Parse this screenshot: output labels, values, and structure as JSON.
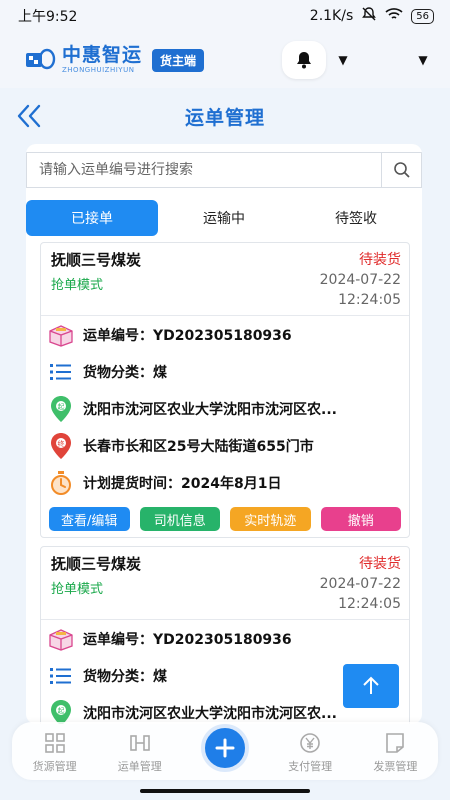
{
  "status_bar": {
    "time": "上午9:52",
    "network_speed": "2.1K/s",
    "battery": "56"
  },
  "header": {
    "brand_name": "中惠智运",
    "brand_sub": "ZHONGHUIZHIYUN",
    "role_badge": "货主端",
    "notification_icon": "bell-icon"
  },
  "nav": {
    "title": "运单管理",
    "back_icon": "double-chevron-left-icon"
  },
  "search": {
    "placeholder": "请输入运单编号进行搜索",
    "value": ""
  },
  "tabs": [
    {
      "label": "已接单",
      "active": true
    },
    {
      "label": "运输中",
      "active": false
    },
    {
      "label": "待签收",
      "active": false
    }
  ],
  "orders": [
    {
      "title": "抚顺三号煤炭",
      "mode": "抢单模式",
      "status": "待装货",
      "date": "2024-07-22",
      "time": "12:24:05",
      "waybill_label": "运单编号：",
      "waybill_no": "YD202305180936",
      "category_label": "货物分类：",
      "category": "煤",
      "origin": "沈阳市沈河区农业大学沈阳市沈河区农...",
      "destination": "长春市长和区25号大陆街道655门市",
      "pickup_label": "计划提货时间：",
      "pickup_time": "2024年8月1日",
      "actions": [
        "查看/编辑",
        "司机信息",
        "实时轨迹",
        "撤销"
      ]
    },
    {
      "title": "抚顺三号煤炭",
      "mode": "抢单模式",
      "status": "待装货",
      "date": "2024-07-22",
      "time": "12:24:05",
      "waybill_label": "运单编号：",
      "waybill_no": "YD202305180936",
      "category_label": "货物分类：",
      "category": "煤",
      "origin": "沈阳市沈河区农业大学沈阳市沈河区农...",
      "destination": "",
      "pickup_label": "",
      "pickup_time": "",
      "actions": []
    }
  ],
  "action_colors": [
    "#1f8bf2",
    "#27b36a",
    "#f5a623",
    "#e8408d"
  ],
  "bottom_nav": [
    {
      "label": "货源管理",
      "icon": "grid-icon"
    },
    {
      "label": "运单管理",
      "icon": "waybill-icon"
    },
    {
      "label": "",
      "icon": "plus-icon"
    },
    {
      "label": "支付管理",
      "icon": "yen-icon"
    },
    {
      "label": "发票管理",
      "icon": "invoice-icon"
    }
  ]
}
